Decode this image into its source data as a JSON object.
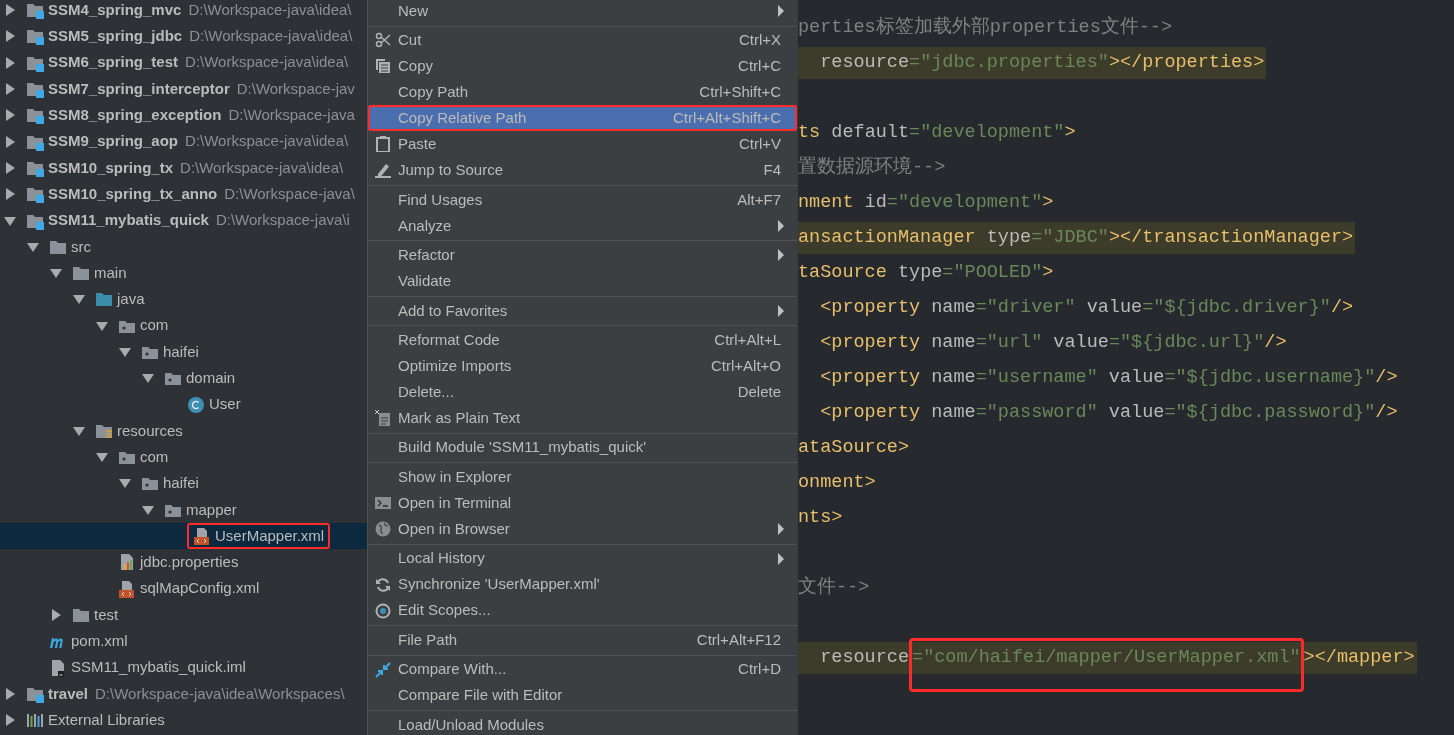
{
  "project_tree": {
    "items": [
      {
        "kind": "module",
        "name": "SSM4_spring_mvc",
        "path": "D:\\Workspace-java\\idea\\",
        "expanded": false,
        "selected": false
      },
      {
        "kind": "module",
        "name": "SSM5_spring_jdbc",
        "path": "D:\\Workspace-java\\idea\\",
        "expanded": false,
        "selected": false
      },
      {
        "kind": "module",
        "name": "SSM6_spring_test",
        "path": "D:\\Workspace-java\\idea\\",
        "expanded": false,
        "selected": false
      },
      {
        "kind": "module",
        "name": "SSM7_spring_interceptor",
        "path": "D:\\Workspace-jav",
        "expanded": false,
        "selected": false
      },
      {
        "kind": "module",
        "name": "SSM8_spring_exception",
        "path": "D:\\Workspace-java",
        "expanded": false,
        "selected": false
      },
      {
        "kind": "module",
        "name": "SSM9_spring_aop",
        "path": "D:\\Workspace-java\\idea\\",
        "expanded": false,
        "selected": false
      },
      {
        "kind": "module",
        "name": "SSM10_spring_tx",
        "path": "D:\\Workspace-java\\idea\\",
        "expanded": false,
        "selected": false
      },
      {
        "kind": "module",
        "name": "SSM10_spring_tx_anno",
        "path": "D:\\Workspace-java\\",
        "expanded": false,
        "selected": false
      },
      {
        "kind": "module",
        "name": "SSM11_mybatis_quick",
        "path": "D:\\Workspace-java\\i",
        "expanded": true,
        "selected": false,
        "children": [
          {
            "kind": "folder",
            "name": "src",
            "expanded": true,
            "selected": false,
            "children": [
              {
                "kind": "folder",
                "name": "main",
                "expanded": true,
                "selected": false,
                "children": [
                  {
                    "kind": "source",
                    "name": "java",
                    "expanded": true,
                    "selected": false,
                    "children": [
                      {
                        "kind": "package",
                        "name": "com",
                        "expanded": true,
                        "selected": false,
                        "children": [
                          {
                            "kind": "package",
                            "name": "haifei",
                            "expanded": true,
                            "selected": false,
                            "children": [
                              {
                                "kind": "package",
                                "name": "domain",
                                "expanded": true,
                                "selected": false,
                                "children": [
                                  {
                                    "kind": "class",
                                    "name": "User",
                                    "selected": false
                                  }
                                ]
                              }
                            ]
                          }
                        ]
                      }
                    ]
                  },
                  {
                    "kind": "resources",
                    "name": "resources",
                    "expanded": true,
                    "selected": false,
                    "children": [
                      {
                        "kind": "package",
                        "name": "com",
                        "expanded": true,
                        "selected": false,
                        "children": [
                          {
                            "kind": "package",
                            "name": "haifei",
                            "expanded": true,
                            "selected": false,
                            "children": [
                              {
                                "kind": "package",
                                "name": "mapper",
                                "expanded": true,
                                "selected": false,
                                "children": [
                                  {
                                    "kind": "xml",
                                    "name": "UserMapper.xml",
                                    "selected": true,
                                    "annotated": true
                                  }
                                ]
                              }
                            ]
                          }
                        ]
                      },
                      {
                        "kind": "properties",
                        "name": "jdbc.properties",
                        "selected": false
                      },
                      {
                        "kind": "xml",
                        "name": "sqlMapConfig.xml",
                        "selected": false
                      }
                    ]
                  }
                ]
              },
              {
                "kind": "folder",
                "name": "test",
                "expanded": false,
                "selected": false
              }
            ]
          },
          {
            "kind": "maven",
            "name": "pom.xml",
            "selected": false
          },
          {
            "kind": "iml",
            "name": "SSM11_mybatis_quick.iml",
            "selected": false
          }
        ]
      },
      {
        "kind": "module",
        "name": "travel",
        "path": "D:\\Workspace-java\\idea\\Workspaces\\",
        "expanded": false,
        "selected": false
      },
      {
        "kind": "libraries",
        "name": "External Libraries",
        "expanded": false,
        "selected": false
      }
    ]
  },
  "context_menu": {
    "items": [
      {
        "kind": "item",
        "label": "New",
        "submenu": true,
        "selected": false
      },
      {
        "kind": "separator"
      },
      {
        "kind": "item",
        "label": "Cut",
        "shortcut": "Ctrl+X",
        "selected": false
      },
      {
        "kind": "item",
        "label": "Copy",
        "shortcut": "Ctrl+C",
        "selected": false
      },
      {
        "kind": "item",
        "label": "Copy Path",
        "shortcut": "Ctrl+Shift+C",
        "selected": false
      },
      {
        "kind": "item",
        "label": "Copy Relative Path",
        "shortcut": "Ctrl+Alt+Shift+C",
        "selected": true,
        "annotated": true
      },
      {
        "kind": "item",
        "label": "Paste",
        "shortcut": "Ctrl+V",
        "selected": false
      },
      {
        "kind": "item",
        "label": "Jump to Source",
        "shortcut": "F4",
        "selected": false
      },
      {
        "kind": "separator"
      },
      {
        "kind": "item",
        "label": "Find Usages",
        "shortcut": "Alt+F7",
        "selected": false
      },
      {
        "kind": "item",
        "label": "Analyze",
        "submenu": true,
        "selected": false
      },
      {
        "kind": "separator"
      },
      {
        "kind": "item",
        "label": "Refactor",
        "submenu": true,
        "selected": false
      },
      {
        "kind": "item",
        "label": "Validate",
        "selected": false
      },
      {
        "kind": "separator"
      },
      {
        "kind": "item",
        "label": "Add to Favorites",
        "submenu": true,
        "selected": false
      },
      {
        "kind": "separator"
      },
      {
        "kind": "item",
        "label": "Reformat Code",
        "shortcut": "Ctrl+Alt+L",
        "selected": false
      },
      {
        "kind": "item",
        "label": "Optimize Imports",
        "shortcut": "Ctrl+Alt+O",
        "selected": false
      },
      {
        "kind": "item",
        "label": "Delete...",
        "shortcut": "Delete",
        "selected": false
      },
      {
        "kind": "item",
        "label": "Mark as Plain Text",
        "selected": false
      },
      {
        "kind": "separator"
      },
      {
        "kind": "item",
        "label": "Build Module 'SSM11_mybatis_quick'",
        "selected": false
      },
      {
        "kind": "separator"
      },
      {
        "kind": "item",
        "label": "Show in Explorer",
        "selected": false
      },
      {
        "kind": "item",
        "label": "Open in Terminal",
        "selected": false
      },
      {
        "kind": "item",
        "label": "Open in Browser",
        "submenu": true,
        "selected": false
      },
      {
        "kind": "separator"
      },
      {
        "kind": "item",
        "label": "Local History",
        "submenu": true,
        "selected": false
      },
      {
        "kind": "item",
        "label": "Synchronize 'UserMapper.xml'",
        "selected": false
      },
      {
        "kind": "item",
        "label": "Edit Scopes...",
        "selected": false
      },
      {
        "kind": "separator"
      },
      {
        "kind": "item",
        "label": "File Path",
        "shortcut": "Ctrl+Alt+F12",
        "selected": false
      },
      {
        "kind": "separator"
      },
      {
        "kind": "item",
        "label": "Compare With...",
        "shortcut": "Ctrl+D",
        "selected": false
      },
      {
        "kind": "item",
        "label": "Compare File with Editor",
        "selected": false
      },
      {
        "kind": "separator"
      },
      {
        "kind": "item",
        "label": "Load/Unload Modules",
        "selected": false
      }
    ]
  },
  "editor": {
    "lines": [
      {
        "kind": "code",
        "highlighted": false,
        "tokens": [
          {
            "kind": "comment",
            "text": "perties标签加载外部properties文件-->"
          }
        ]
      },
      {
        "kind": "code",
        "highlighted": true,
        "tokens": [
          {
            "kind": "attr",
            "text": "  resource"
          },
          {
            "kind": "value",
            "text": "=\"jdbc.properties\""
          },
          {
            "kind": "tag",
            "text": "></properties>"
          }
        ]
      },
      {
        "kind": "blank"
      },
      {
        "kind": "code",
        "highlighted": false,
        "tokens": [
          {
            "kind": "tag",
            "text": "ts"
          },
          {
            "kind": "attr",
            "text": " default"
          },
          {
            "kind": "value",
            "text": "=\"development\""
          },
          {
            "kind": "tag",
            "text": ">"
          }
        ]
      },
      {
        "kind": "code",
        "highlighted": false,
        "tokens": [
          {
            "kind": "comment",
            "text": "置数据源环境-->"
          }
        ]
      },
      {
        "kind": "code",
        "highlighted": false,
        "tokens": [
          {
            "kind": "tag",
            "text": "nment"
          },
          {
            "kind": "attr",
            "text": " id"
          },
          {
            "kind": "value",
            "text": "=\"development\""
          },
          {
            "kind": "tag",
            "text": ">"
          }
        ]
      },
      {
        "kind": "code",
        "highlighted": true,
        "tokens": [
          {
            "kind": "tag",
            "text": "ansactionManager"
          },
          {
            "kind": "attr",
            "text": " type"
          },
          {
            "kind": "value",
            "text": "=\"JDBC\""
          },
          {
            "kind": "tag",
            "text": "></transactionManager>"
          }
        ]
      },
      {
        "kind": "code",
        "highlighted": false,
        "tokens": [
          {
            "kind": "tag",
            "text": "taSource"
          },
          {
            "kind": "attr",
            "text": " type"
          },
          {
            "kind": "value",
            "text": "=\"POOLED\""
          },
          {
            "kind": "tag",
            "text": ">"
          }
        ]
      },
      {
        "kind": "code",
        "highlighted": false,
        "tokens": [
          {
            "kind": "tag",
            "text": "  <property"
          },
          {
            "kind": "attr",
            "text": " name"
          },
          {
            "kind": "value",
            "text": "=\"driver\""
          },
          {
            "kind": "attr",
            "text": " value"
          },
          {
            "kind": "value",
            "text": "=\"${jdbc.driver}\""
          },
          {
            "kind": "tag",
            "text": "/>"
          }
        ]
      },
      {
        "kind": "code",
        "highlighted": false,
        "tokens": [
          {
            "kind": "tag",
            "text": "  <property"
          },
          {
            "kind": "attr",
            "text": " name"
          },
          {
            "kind": "value",
            "text": "=\"url\""
          },
          {
            "kind": "attr",
            "text": " value"
          },
          {
            "kind": "value",
            "text": "=\"${jdbc.url}\""
          },
          {
            "kind": "tag",
            "text": "/>"
          }
        ]
      },
      {
        "kind": "code",
        "highlighted": false,
        "tokens": [
          {
            "kind": "tag",
            "text": "  <property"
          },
          {
            "kind": "attr",
            "text": " name"
          },
          {
            "kind": "value",
            "text": "=\"username\""
          },
          {
            "kind": "attr",
            "text": " value"
          },
          {
            "kind": "value",
            "text": "=\"${jdbc.username}\""
          },
          {
            "kind": "tag",
            "text": "/>"
          }
        ]
      },
      {
        "kind": "code",
        "highlighted": false,
        "tokens": [
          {
            "kind": "tag",
            "text": "  <property"
          },
          {
            "kind": "attr",
            "text": " name"
          },
          {
            "kind": "value",
            "text": "=\"password\""
          },
          {
            "kind": "attr",
            "text": " value"
          },
          {
            "kind": "value",
            "text": "=\"${jdbc.password}\""
          },
          {
            "kind": "tag",
            "text": "/>"
          }
        ]
      },
      {
        "kind": "code",
        "highlighted": false,
        "tokens": [
          {
            "kind": "tag",
            "text": "ataSource>"
          }
        ]
      },
      {
        "kind": "code",
        "highlighted": false,
        "tokens": [
          {
            "kind": "tag",
            "text": "onment>"
          }
        ]
      },
      {
        "kind": "code",
        "highlighted": false,
        "tokens": [
          {
            "kind": "tag",
            "text": "nts>"
          }
        ]
      },
      {
        "kind": "blank"
      },
      {
        "kind": "code",
        "highlighted": false,
        "tokens": [
          {
            "kind": "comment",
            "text": "文件-->"
          }
        ]
      },
      {
        "kind": "blank"
      },
      {
        "kind": "code",
        "highlighted": true,
        "tokens": [
          {
            "kind": "attr",
            "text": "  resource"
          },
          {
            "kind": "value",
            "text": "=\"com/haifei/mapper/UserMapper.xml\"",
            "annotated": true
          },
          {
            "kind": "tag",
            "text": "></mapper>"
          }
        ]
      }
    ]
  }
}
